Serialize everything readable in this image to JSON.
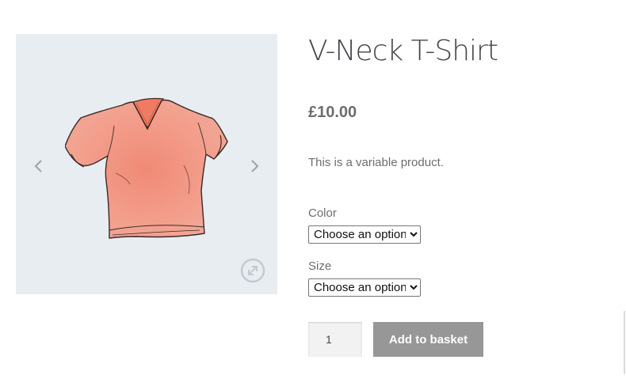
{
  "product": {
    "title": "V-Neck T-Shirt",
    "price": "£10.00",
    "description": "This is a variable product.",
    "image_icon": "tshirt-image",
    "image_color": "#f4907c"
  },
  "gallery": {
    "prev_icon": "chevron-left-icon",
    "next_icon": "chevron-right-icon",
    "zoom_icon": "expand-icon"
  },
  "attributes": {
    "color": {
      "label": "Color",
      "selected": "Choose an option"
    },
    "size": {
      "label": "Size",
      "selected": "Choose an option"
    }
  },
  "cart": {
    "quantity": "1",
    "add_label": "Add to basket",
    "button_color": "#979797"
  }
}
